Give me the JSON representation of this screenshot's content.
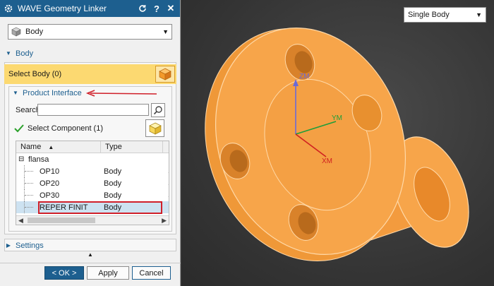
{
  "dialog": {
    "title": "WAVE Geometry Linker",
    "type_value": "Body",
    "body_section": "Body",
    "select_body": "Select Body (0)",
    "product_interface": "Product Interface",
    "search_label": "Search",
    "search_value": "",
    "select_component": "Select Component (1)",
    "table": {
      "headers": [
        "Name",
        "Type"
      ],
      "root": "flansa",
      "rows": [
        {
          "name": "OP10",
          "type": "Body"
        },
        {
          "name": "OP20",
          "type": "Body"
        },
        {
          "name": "OP30",
          "type": "Body"
        },
        {
          "name": "REPER FINIT",
          "type": "Body"
        }
      ]
    },
    "settings": "Settings",
    "buttons": {
      "ok": "< OK >",
      "apply": "Apply",
      "cancel": "Cancel"
    }
  },
  "viewport": {
    "filter_value": "Single Body",
    "axes": {
      "z": "ZM",
      "y": "YM",
      "x": "XM"
    }
  },
  "colors": {
    "accent": "#1d5f8f",
    "select_highlight": "#fcd971",
    "part_fill": "#f7a54a",
    "highlight_border": "#d0202a"
  }
}
